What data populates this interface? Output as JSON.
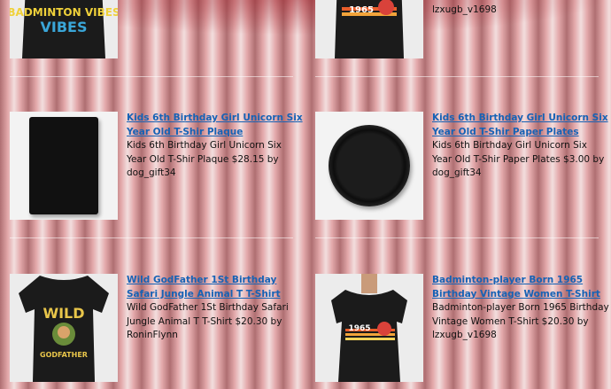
{
  "products": [
    {
      "title": "",
      "description": "",
      "thumb": "badminton-vibes-tshirt",
      "thumb_text": "BADMINTON VIBES"
    },
    {
      "title": "",
      "description": "lzxugb_v1698",
      "thumb": "1965-women-tshirt",
      "thumb_text": "1965"
    },
    {
      "title": "Kids 6th Birthday Girl Unicorn Six Year Old T-Shir Plaque",
      "description": "Kids 6th Birthday Girl Unicorn Six Year Old T-Shir Plaque $28.15 by dog_gift34",
      "thumb": "plaque"
    },
    {
      "title": "Kids 6th Birthday Girl Unicorn Six Year Old T-Shir Paper Plates",
      "description": "Kids 6th Birthday Girl Unicorn Six Year Old T-Shir Paper Plates $3.00 by dog_gift34",
      "thumb": "paper-plate"
    },
    {
      "title": "Wild GodFather 1St Birthday Safari Jungle Animal T T-Shirt",
      "description": "Wild GodFather 1St Birthday Safari Jungle Animal T T-Shirt $20.30 by RoninFlynn",
      "thumb": "wild-godfather-tshirt",
      "thumb_text_top": "WILD",
      "thumb_text_bottom": "GODFATHER"
    },
    {
      "title": "Badminton-player Born 1965 Birthday Vintage Women T-Shirt",
      "description": "Badminton-player Born 1965 Birthday Vintage Women T-Shirt $20.30 by lzxugb_v1698",
      "thumb": "1965-women-tshirt",
      "thumb_text": "1965"
    }
  ],
  "colors": {
    "link": "#1662b5",
    "curtain": "#a8232b",
    "shirt": "#161616"
  }
}
